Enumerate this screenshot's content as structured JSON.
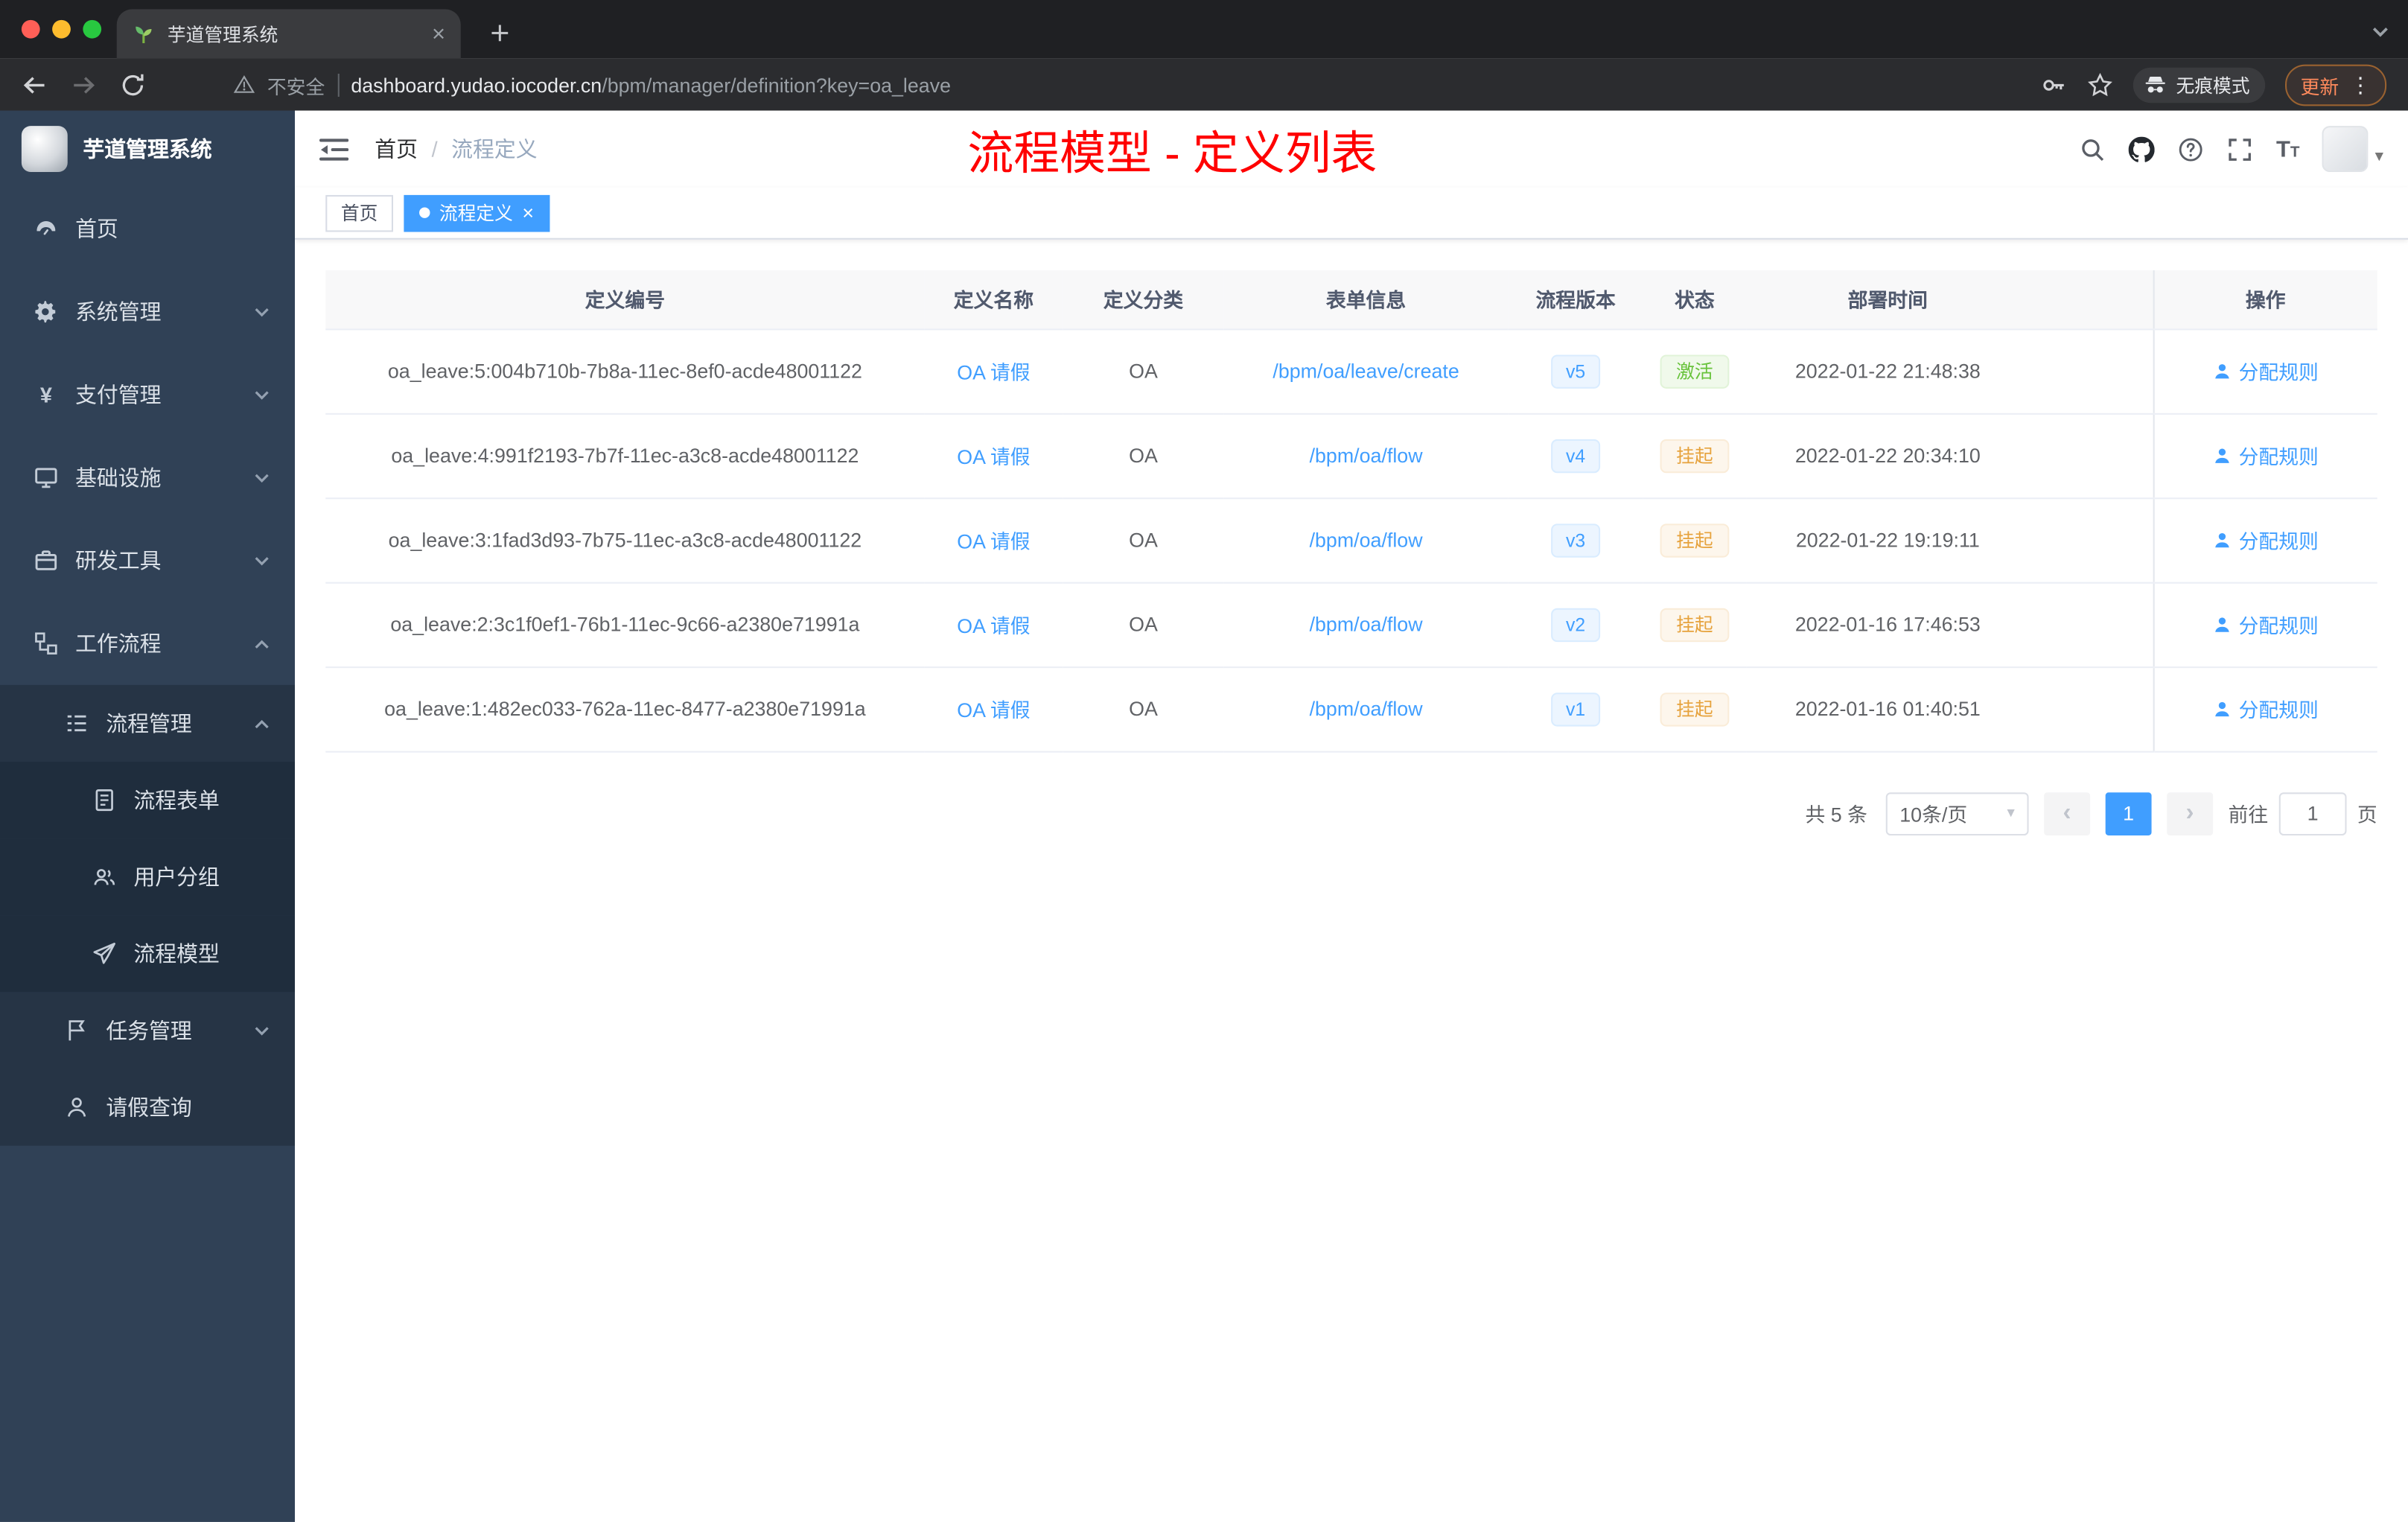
{
  "browser": {
    "tab_title": "芋道管理系统",
    "security_label": "不安全",
    "url_host": "dashboard.yudao.iocoder.cn",
    "url_path": "/bpm/manager/definition?key=oa_leave",
    "incognito_label": "无痕模式",
    "update_label": "更新"
  },
  "sidebar": {
    "logo_title": "芋道管理系统",
    "items": [
      {
        "label": "首页"
      },
      {
        "label": "系统管理"
      },
      {
        "label": "支付管理"
      },
      {
        "label": "基础设施"
      },
      {
        "label": "研发工具"
      },
      {
        "label": "工作流程"
      },
      {
        "label": "流程管理"
      },
      {
        "label": "流程表单"
      },
      {
        "label": "用户分组"
      },
      {
        "label": "流程模型"
      },
      {
        "label": "任务管理"
      },
      {
        "label": "请假查询"
      }
    ]
  },
  "header": {
    "breadcrumb_home": "首页",
    "breadcrumb_current": "流程定义",
    "annotation": "流程模型 - 定义列表"
  },
  "tags": {
    "home": "首页",
    "active": "流程定义"
  },
  "table": {
    "columns": [
      "定义编号",
      "定义名称",
      "定义分类",
      "表单信息",
      "流程版本",
      "状态",
      "部署时间",
      "操作"
    ],
    "action_label": "分配规则",
    "rows": [
      {
        "id": "oa_leave:5:004b710b-7b8a-11ec-8ef0-acde48001122",
        "name": "OA 请假",
        "category": "OA",
        "form": "/bpm/oa/leave/create",
        "version": "v5",
        "status": "激活",
        "time": "2022-01-22 21:48:38"
      },
      {
        "id": "oa_leave:4:991f2193-7b7f-11ec-a3c8-acde48001122",
        "name": "OA 请假",
        "category": "OA",
        "form": "/bpm/oa/flow",
        "version": "v4",
        "status": "挂起",
        "time": "2022-01-22 20:34:10"
      },
      {
        "id": "oa_leave:3:1fad3d93-7b75-11ec-a3c8-acde48001122",
        "name": "OA 请假",
        "category": "OA",
        "form": "/bpm/oa/flow",
        "version": "v3",
        "status": "挂起",
        "time": "2022-01-22 19:19:11"
      },
      {
        "id": "oa_leave:2:3c1f0ef1-76b1-11ec-9c66-a2380e71991a",
        "name": "OA 请假",
        "category": "OA",
        "form": "/bpm/oa/flow",
        "version": "v2",
        "status": "挂起",
        "time": "2022-01-16 17:46:53"
      },
      {
        "id": "oa_leave:1:482ec033-762a-11ec-8477-a2380e71991a",
        "name": "OA 请假",
        "category": "OA",
        "form": "/bpm/oa/flow",
        "version": "v1",
        "status": "挂起",
        "time": "2022-01-16 01:40:51"
      }
    ]
  },
  "pagination": {
    "total": "共 5 条",
    "page_size": "10条/页",
    "current_page": "1",
    "goto_label": "前往",
    "goto_value": "1",
    "page_unit": "页"
  },
  "colors": {
    "accent": "#409eff",
    "success": "#67c23a",
    "warning": "#e6a23c",
    "annotation_red": "#ff0000",
    "sidebar_bg": "#304156"
  },
  "icons": {
    "tab_favicon": "green-sprout",
    "security": "warning-triangle",
    "incognito": "spy-hat-glasses",
    "header_icons": [
      "search",
      "github",
      "question-circle",
      "fullscreen",
      "font-size"
    ],
    "action_icon": "user"
  }
}
